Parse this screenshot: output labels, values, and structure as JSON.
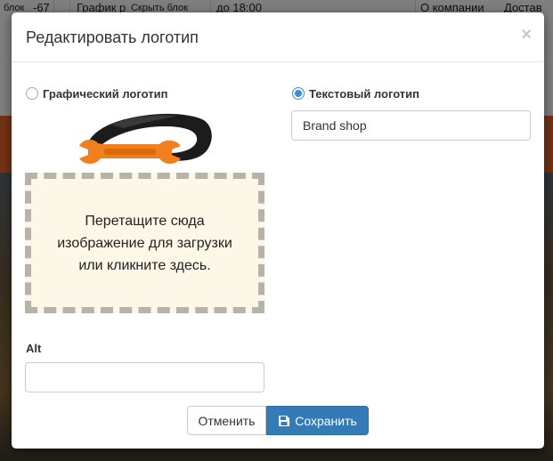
{
  "background": {
    "cells": [
      "блок",
      "-67",
      "График р",
      "Скрыть блок",
      "до 18:00",
      "О компании",
      "Достав"
    ]
  },
  "modal": {
    "title": "Редактировать логотип",
    "close": "×",
    "graphic_option": {
      "label": "Графический логотип",
      "selected": false
    },
    "text_option": {
      "label": "Текстовый логотип",
      "selected": true
    },
    "brand_value": "Brand shop",
    "logo_icon": "car-wrench-logo",
    "dropzone_text": "Перетащите сюда изображение для загрузки или кликните здесь.",
    "alt_label": "Alt",
    "alt_value": "",
    "cancel_label": "Отменить",
    "save_label": "Сохранить",
    "save_icon": "save-icon",
    "accent_color": "#337ab7",
    "brand_color": "#f07f1e"
  }
}
